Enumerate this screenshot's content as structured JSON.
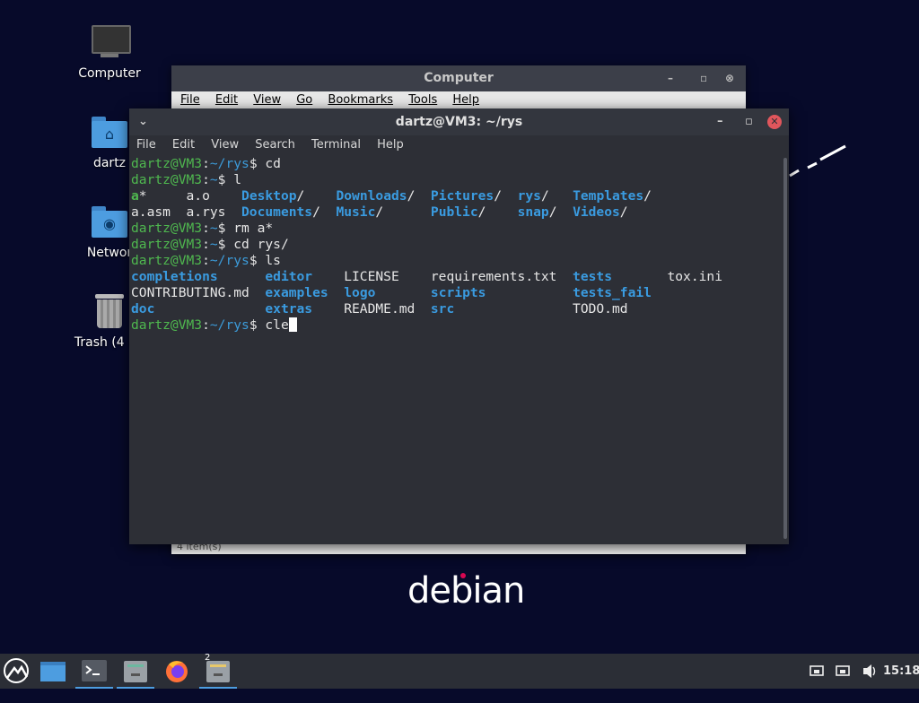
{
  "desktop": {
    "icons": [
      {
        "label": "Computer"
      },
      {
        "label": "dartz"
      },
      {
        "label": "Networ"
      },
      {
        "label": "Trash (4 ite"
      }
    ],
    "branding": "debian"
  },
  "file_manager": {
    "title": "Computer",
    "menu": [
      "File",
      "Edit",
      "View",
      "Go",
      "Bookmarks",
      "Tools",
      "Help"
    ],
    "status": "4 item(s)"
  },
  "terminal": {
    "title": "dartz@VM3: ~/rys",
    "menu": [
      "File",
      "Edit",
      "View",
      "Search",
      "Terminal",
      "Help"
    ],
    "lines": [
      [
        {
          "t": "dartz@VM3",
          "c": "user"
        },
        {
          "t": ":"
        },
        {
          "t": "~/rys",
          "c": "path"
        },
        {
          "t": "$ cd"
        }
      ],
      [
        {
          "t": "dartz@VM3",
          "c": "user"
        },
        {
          "t": ":"
        },
        {
          "t": "~",
          "c": "path"
        },
        {
          "t": "$ l"
        }
      ],
      [
        {
          "t": "a",
          "c": "exec"
        },
        {
          "t": "*     a.o    "
        },
        {
          "t": "Desktop",
          "c": "dir"
        },
        {
          "t": "/    "
        },
        {
          "t": "Downloads",
          "c": "dir"
        },
        {
          "t": "/  "
        },
        {
          "t": "Pictures",
          "c": "dir"
        },
        {
          "t": "/  "
        },
        {
          "t": "rys",
          "c": "dir"
        },
        {
          "t": "/   "
        },
        {
          "t": "Templates",
          "c": "dir"
        },
        {
          "t": "/"
        }
      ],
      [
        {
          "t": "a.asm  a.rys  "
        },
        {
          "t": "Documents",
          "c": "dir"
        },
        {
          "t": "/  "
        },
        {
          "t": "Music",
          "c": "dir"
        },
        {
          "t": "/      "
        },
        {
          "t": "Public",
          "c": "dir"
        },
        {
          "t": "/    "
        },
        {
          "t": "snap",
          "c": "dir"
        },
        {
          "t": "/  "
        },
        {
          "t": "Videos",
          "c": "dir"
        },
        {
          "t": "/"
        }
      ],
      [
        {
          "t": "dartz@VM3",
          "c": "user"
        },
        {
          "t": ":"
        },
        {
          "t": "~",
          "c": "path"
        },
        {
          "t": "$ rm a*"
        }
      ],
      [
        {
          "t": "dartz@VM3",
          "c": "user"
        },
        {
          "t": ":"
        },
        {
          "t": "~",
          "c": "path"
        },
        {
          "t": "$ cd rys/"
        }
      ],
      [
        {
          "t": "dartz@VM3",
          "c": "user"
        },
        {
          "t": ":"
        },
        {
          "t": "~/rys",
          "c": "path"
        },
        {
          "t": "$ ls"
        }
      ],
      [
        {
          "t": "completions",
          "c": "dir"
        },
        {
          "t": "      "
        },
        {
          "t": "editor",
          "c": "dir"
        },
        {
          "t": "    LICENSE    requirements.txt  "
        },
        {
          "t": "tests",
          "c": "dir"
        },
        {
          "t": "       tox.ini"
        }
      ],
      [
        {
          "t": "CONTRIBUTING.md  "
        },
        {
          "t": "examples",
          "c": "dir"
        },
        {
          "t": "  "
        },
        {
          "t": "logo",
          "c": "dir"
        },
        {
          "t": "       "
        },
        {
          "t": "scripts",
          "c": "dir"
        },
        {
          "t": "           "
        },
        {
          "t": "tests_fail",
          "c": "dir"
        }
      ],
      [
        {
          "t": "doc",
          "c": "dir"
        },
        {
          "t": "              "
        },
        {
          "t": "extras",
          "c": "dir"
        },
        {
          "t": "    README.md  "
        },
        {
          "t": "src",
          "c": "dir"
        },
        {
          "t": "               TODO.md"
        }
      ],
      [
        {
          "t": "dartz@VM3",
          "c": "user"
        },
        {
          "t": ":"
        },
        {
          "t": "~/rys",
          "c": "path"
        },
        {
          "t": "$ cle"
        }
      ]
    ]
  },
  "taskbar": {
    "workspace_badge": "2",
    "clock": "15:18"
  },
  "colors": {
    "desktop_bg": "#070a2a",
    "terminal_bg": "#2d2f36",
    "prompt_user": "#4fb84f",
    "prompt_path": "#3c9bd9",
    "directory": "#3a9be0",
    "close_button": "#e0565c"
  }
}
